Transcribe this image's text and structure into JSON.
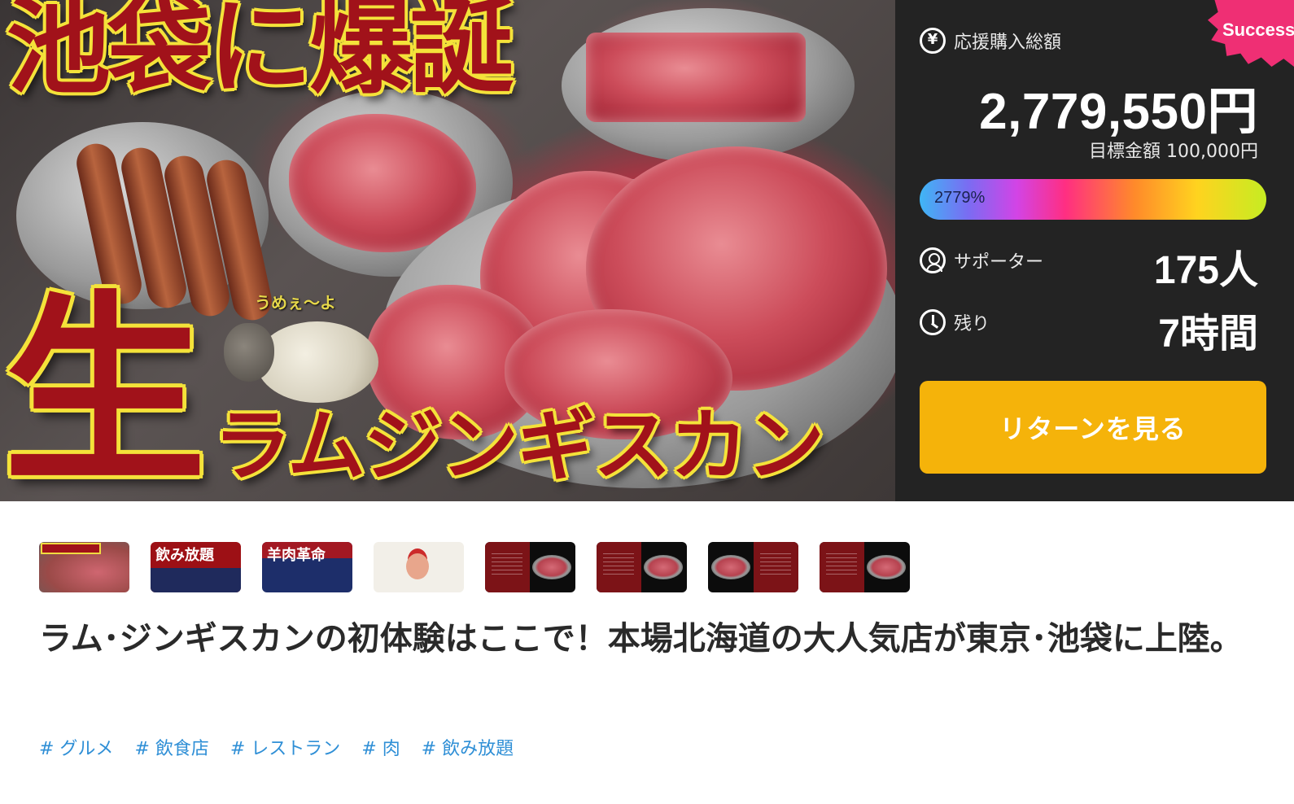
{
  "hero": {
    "title_line": "池袋に爆誕",
    "nama": "生",
    "sub_line": "ラムジンギスカン",
    "sheep_says": "うめぇ〜よ"
  },
  "stats": {
    "badge": "Success",
    "total_label": "応援購入総額",
    "total_value": "2,779,550円",
    "goal_text": "目標金額 100,000円",
    "progress_percent_text": "2779%",
    "progress_fraction": 1.0,
    "supporters_label": "サポーター",
    "supporters_value": "175人",
    "remaining_label": "残り",
    "remaining_value": "7時間",
    "return_button": "リターンを見る"
  },
  "icons": {
    "total": "yen-circle-icon",
    "supporters": "user-circle-icon",
    "remaining": "clock-icon"
  },
  "thumbnails": {
    "t2_text": "飲み放題",
    "t3_text": "羊肉革命"
  },
  "title": "ラム･ジンギスカンの初体験はここで！本場北海道の大人気店が東京･池袋に上陸。",
  "tags": [
    "# グルメ",
    "# 飲食店",
    "# レストラン",
    "# 肉",
    "# 飲み放題"
  ],
  "colors": {
    "accent_button": "#f5b30a",
    "badge": "#ef2f74",
    "tag": "#2f8fd6",
    "panel_bg": "#232323"
  }
}
